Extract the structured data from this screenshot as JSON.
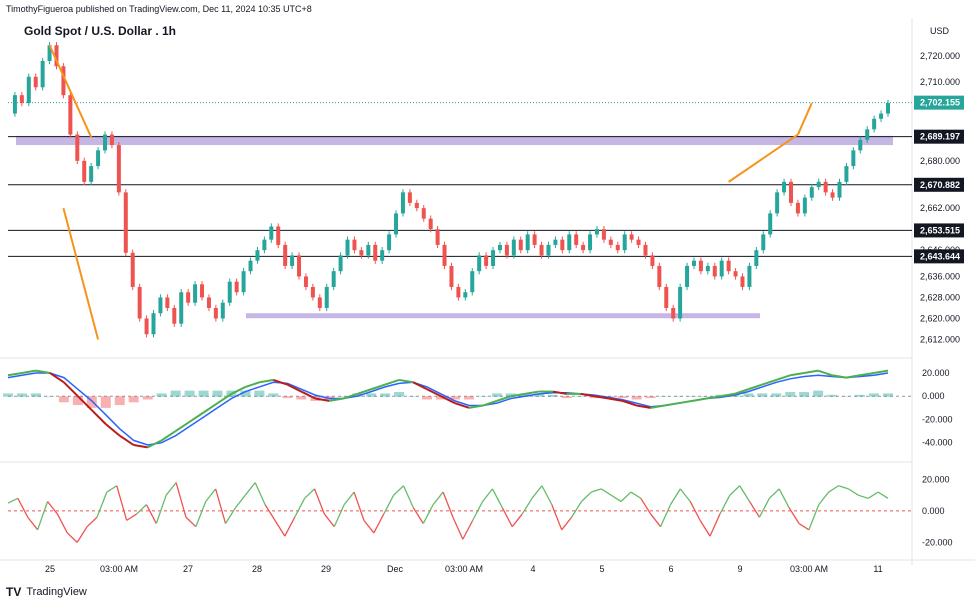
{
  "header": {
    "publisher": "TimothyFigueroa published on TradingView.com, Dec 11, 2024 10:35 UTC+8",
    "title": "Gold Spot / U.S. Dollar . 1h",
    "currency": "USD"
  },
  "footer": {
    "logo_mark": "TV",
    "logo_text": "TradingView"
  },
  "colors": {
    "up": "#26a69a",
    "down": "#ef5350",
    "zone": "#b39ddb",
    "trend": "#f7931a",
    "osc_green": "#4caf50",
    "osc_red": "#b71c1c",
    "osc_blue": "#2962ff",
    "rsi_green": "#66bb6a",
    "rsi_red": "#ef5350"
  },
  "chart_data": {
    "type": "candlestick",
    "symbol": "Gold Spot / U.S. Dollar",
    "timeframe": "1h",
    "x_tick_labels": [
      "25",
      "03:00 AM",
      "27",
      "28",
      "29",
      "Dec",
      "03:00 AM",
      "4",
      "5",
      "6",
      "9",
      "03:00 AM",
      "11"
    ],
    "price_axis_ticks": [
      "2,720.000",
      "2,710.000",
      "2,702.155",
      "2,689.197",
      "2,680.000",
      "2,670.882",
      "2,662.000",
      "2,653.515",
      "2,646.000",
      "2,643.644",
      "2,636.000",
      "2,628.000",
      "2,620.000",
      "2,612.000"
    ],
    "ylim": [
      2608,
      2726
    ],
    "horizontal_levels": [
      {
        "label": "2,689.197",
        "price": 2689.197
      },
      {
        "label": "2,670.882",
        "price": 2670.882
      },
      {
        "label": "2,653.515",
        "price": 2653.515
      },
      {
        "label": "2,643.644",
        "price": 2643.644
      }
    ],
    "last_price_label": "2,702.155",
    "last_price": 2702.155,
    "zones": [
      {
        "price_low": 2686.0,
        "price_high": 2689.5
      },
      {
        "price_low": 2620.5,
        "price_high": 2622.0
      }
    ],
    "price_series": [
      2698,
      2705,
      2702,
      2712,
      2708,
      2718,
      2724,
      2716,
      2705,
      2690,
      2680,
      2672,
      2678,
      2684,
      2690,
      2686,
      2668,
      2645,
      2632,
      2620,
      2614,
      2622,
      2628,
      2624,
      2618,
      2630,
      2626,
      2633,
      2628,
      2624,
      2620,
      2626,
      2634,
      2630,
      2638,
      2642,
      2646,
      2650,
      2655,
      2648,
      2640,
      2644,
      2636,
      2632,
      2628,
      2624,
      2632,
      2638,
      2644,
      2650,
      2646,
      2644,
      2648,
      2642,
      2646,
      2652,
      2660,
      2668,
      2664,
      2662,
      2658,
      2654,
      2648,
      2640,
      2632,
      2628,
      2630,
      2638,
      2644,
      2640,
      2646,
      2648,
      2644,
      2650,
      2646,
      2652,
      2648,
      2644,
      2648,
      2650,
      2646,
      2652,
      2648,
      2646,
      2652,
      2654,
      2650,
      2648,
      2646,
      2652,
      2650,
      2648,
      2644,
      2640,
      2632,
      2624,
      2620,
      2632,
      2640,
      2642,
      2638,
      2640,
      2636,
      2642,
      2638,
      2636,
      2632,
      2640,
      2646,
      2652,
      2660,
      2668,
      2672,
      2664,
      2660,
      2666,
      2670,
      2672,
      2668,
      2666,
      2672,
      2678,
      2684,
      2688,
      2692,
      2696,
      2698,
      2702
    ],
    "osc_axis_ticks": [
      "20.000",
      "0.000",
      "-20.000",
      "-40.000"
    ],
    "osc_ylim": [
      -48,
      26
    ],
    "osc_fast": [
      18,
      20,
      22,
      20,
      12,
      0,
      -12,
      -24,
      -34,
      -42,
      -44,
      -38,
      -30,
      -22,
      -14,
      -6,
      2,
      8,
      12,
      14,
      10,
      4,
      -2,
      -4,
      -2,
      2,
      6,
      10,
      14,
      12,
      6,
      0,
      -6,
      -10,
      -8,
      -4,
      0,
      2,
      4,
      4,
      2,
      2,
      0,
      -2,
      -4,
      -8,
      -10,
      -8,
      -6,
      -4,
      -2,
      0,
      2,
      6,
      10,
      14,
      18,
      20,
      22,
      18,
      16,
      18,
      20,
      22
    ],
    "osc_slow": [
      16,
      18,
      20,
      20,
      16,
      6,
      -4,
      -16,
      -28,
      -38,
      -42,
      -40,
      -34,
      -26,
      -18,
      -10,
      -2,
      4,
      8,
      12,
      11,
      6,
      1,
      -2,
      -2,
      0,
      4,
      8,
      11,
      12,
      8,
      2,
      -4,
      -8,
      -8,
      -6,
      -2,
      0,
      2,
      3,
      3,
      2,
      1,
      -1,
      -3,
      -6,
      -9,
      -8,
      -6,
      -4,
      -2,
      -1,
      1,
      4,
      8,
      12,
      15,
      17,
      18,
      17,
      16,
      17,
      18,
      20
    ],
    "rsi_axis_ticks": [
      "20.000",
      "0.000",
      "-20.000"
    ],
    "rsi_ylim": [
      -28,
      26
    ],
    "rsi_series": [
      5,
      8,
      -4,
      -12,
      6,
      -2,
      -14,
      -20,
      -10,
      -4,
      12,
      16,
      -6,
      -2,
      4,
      -8,
      10,
      18,
      -4,
      -10,
      6,
      14,
      -8,
      2,
      10,
      18,
      4,
      -6,
      -16,
      -4,
      8,
      14,
      -2,
      -10,
      4,
      12,
      -6,
      -14,
      -2,
      10,
      16,
      2,
      -8,
      4,
      12,
      -4,
      -18,
      -6,
      6,
      14,
      2,
      -10,
      -2,
      8,
      16,
      4,
      -12,
      -4,
      6,
      12,
      14,
      10,
      6,
      12,
      8,
      -2,
      -10,
      4,
      14,
      6,
      -6,
      -16,
      -2,
      10,
      16,
      6,
      -4,
      8,
      14,
      2,
      -8,
      -12,
      4,
      12,
      16,
      14,
      10,
      8,
      12,
      8
    ]
  }
}
